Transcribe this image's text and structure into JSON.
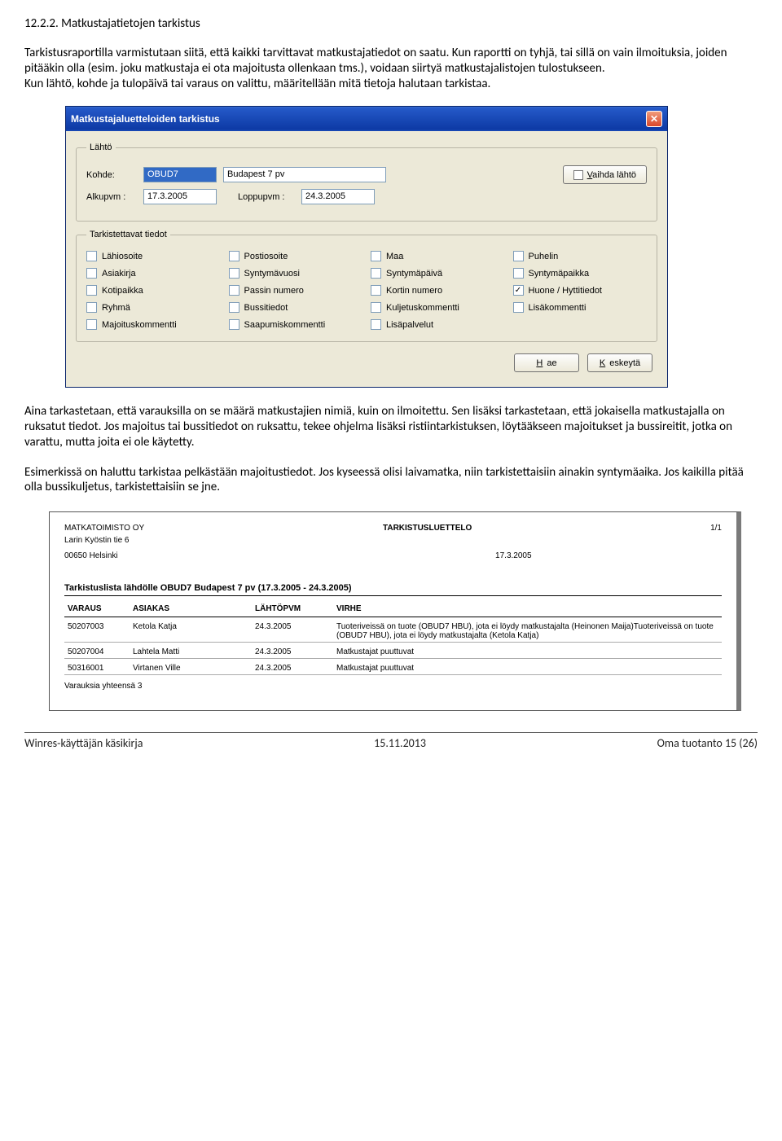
{
  "doc": {
    "heading": "12.2.2. Matkustajatietojen tarkistus",
    "para1": "Tarkistusraportilla varmistutaan siitä, että kaikki tarvittavat matkustajatiedot on saatu. Kun raportti on tyhjä, tai sillä on vain ilmoituksia, joiden pitääkin olla (esim. joku matkustaja ei ota majoitusta ollenkaan tms.), voidaan siirtyä matkustajalistojen tulostukseen.",
    "para1b": "Kun lähtö, kohde ja tulopäivä tai varaus on valittu, määritellään mitä tietoja halutaan tarkistaa.",
    "para2": "Aina tarkastetaan, että varauksilla on se määrä matkustajien nimiä, kuin on ilmoitettu. Sen lisäksi tarkastetaan, että jokaisella matkustajalla on ruksatut tiedot. Jos majoitus tai bussitiedot on ruksattu, tekee ohjelma lisäksi ristiintarkistuksen, löytääkseen majoitukset ja bussireitit, jotka on varattu, mutta joita ei ole käytetty.",
    "para3": "Esimerkissä on haluttu tarkistaa pelkästään majoitustiedot. Jos kyseessä olisi laivamatka, niin tarkistettaisiin ainakin syntymäaika. Jos kaikilla pitää olla bussikuljetus, tarkistettaisiin se jne."
  },
  "dialog": {
    "title": "Matkustajaluetteloiden tarkistus",
    "group_lahto": "Lähtö",
    "kohde_label": "Kohde:",
    "kohde_code": "OBUD7",
    "kohde_name": "Budapest 7 pv",
    "vaihda_btn": "Vaihda lähtö",
    "alkupvm_label": "Alkupvm :",
    "alkupvm": "17.3.2005",
    "loppupvm_label": "Loppupvm :",
    "loppupvm": "24.3.2005",
    "group_tark": "Tarkistettavat tiedot",
    "checks": [
      {
        "label": "Lähiosoite",
        "checked": false
      },
      {
        "label": "Postiosoite",
        "checked": false
      },
      {
        "label": "Maa",
        "checked": false
      },
      {
        "label": "Puhelin",
        "checked": false
      },
      {
        "label": "Asiakirja",
        "checked": false
      },
      {
        "label": "Syntymävuosi",
        "checked": false
      },
      {
        "label": "Syntymäpäivä",
        "checked": false
      },
      {
        "label": "Syntymäpaikka",
        "checked": false
      },
      {
        "label": "Kotipaikka",
        "checked": false
      },
      {
        "label": "Passin numero",
        "checked": false
      },
      {
        "label": "Kortin numero",
        "checked": false
      },
      {
        "label": "Huone / Hyttitiedot",
        "checked": true
      },
      {
        "label": "Ryhmä",
        "checked": false
      },
      {
        "label": "Bussitiedot",
        "checked": false
      },
      {
        "label": "Kuljetuskommentti",
        "checked": false
      },
      {
        "label": "Lisäkommentti",
        "checked": false
      },
      {
        "label": "Majoituskommentti",
        "checked": false
      },
      {
        "label": "Saapumiskommentti",
        "checked": false
      },
      {
        "label": "Lisäpalvelut",
        "checked": false
      }
    ],
    "btn_hae": "Hae",
    "btn_keskeyta": "Keskeytä"
  },
  "report": {
    "company": "MATKATOIMISTO OY",
    "doc_title": "TARKISTUSLUETTELO",
    "page": "1/1",
    "addr1": "Larin Kyöstin tie 6",
    "addr2": "00650 Helsinki",
    "date": "17.3.2005",
    "list_title": "Tarkistuslista lähdölle OBUD7 Budapest 7 pv (17.3.2005 - 24.3.2005)",
    "cols": {
      "c1": "VARAUS",
      "c2": "ASIAKAS",
      "c3": "LÄHTÖPVM",
      "c4": "VIRHE"
    },
    "rows": [
      {
        "varaus": "50207003",
        "asiakas": "Ketola Katja",
        "pvm": "24.3.2005",
        "virhe": "Tuoteriveissä on tuote (OBUD7 HBU), jota ei löydy matkustajalta (Heinonen Maija)Tuoteriveissä on tuote (OBUD7 HBU), jota ei löydy matkustajalta (Ketola Katja)"
      },
      {
        "varaus": "50207004",
        "asiakas": "Lahtela Matti",
        "pvm": "24.3.2005",
        "virhe": "Matkustajat puuttuvat"
      },
      {
        "varaus": "50316001",
        "asiakas": "Virtanen Ville",
        "pvm": "24.3.2005",
        "virhe": "Matkustajat puuttuvat"
      }
    ],
    "footer_count": "Varauksia yhteensä 3"
  },
  "pagefoot": {
    "left": "Winres-käyttäjän käsikirja",
    "center": "15.11.2013",
    "right": "Oma tuotanto 15 (26)"
  }
}
